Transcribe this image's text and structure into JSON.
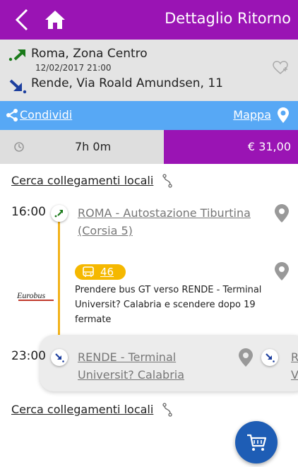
{
  "header": {
    "title": "Dettaglio Ritorno",
    "back_icon": "chevron-left-icon",
    "home_icon": "home-icon",
    "color": "#9a14b4"
  },
  "route": {
    "from": "Roma, Zona Centro",
    "datetime": "12/02/2017 21:00",
    "to": "Rende, Via Roald Amundsen, 11",
    "favorite_icon": "heart-plus-icon"
  },
  "share": {
    "share_label": "Condividi",
    "map_label": "Mappa",
    "color": "#57a8f5"
  },
  "summary": {
    "duration": "7h 0m",
    "price": "€ 31,00"
  },
  "local_links": {
    "label_top": "Cerca collegamenti locali",
    "label_bottom": "Cerca collegamenti locali"
  },
  "departure": {
    "time": "16:00",
    "stop_line1": "ROMA - Autostazione Tiburtina",
    "stop_line2": "(Corsia 5)"
  },
  "ride": {
    "bus_number": "46",
    "operator_logo_text": "Eurobus",
    "instruction": "Prendere bus GT verso RENDE - Terminal Universit? Calabria e scendere dopo 19 fermate",
    "badge_color": "#f5b800"
  },
  "arrival": {
    "time": "23:00",
    "stop_line1": "RENDE - Terminal",
    "stop_line2": "Universit? Calabria",
    "next_partial_1": "R",
    "next_partial_2": "V"
  },
  "cart": {
    "icon": "cart-icon",
    "color": "#1e5db5"
  }
}
